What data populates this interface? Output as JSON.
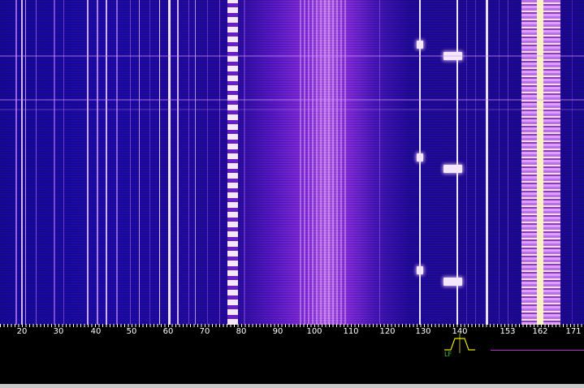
{
  "frequency_axis": {
    "labels": [
      "20",
      "30",
      "40",
      "50",
      "60",
      "70",
      "80",
      "90",
      "100",
      "110",
      "120",
      "130",
      "140",
      "153",
      "162",
      "171"
    ]
  },
  "filter": {
    "label": "LF",
    "color": "#37c837"
  },
  "colors": {
    "background": "#000000",
    "waterfall_base": "#1d0aa8",
    "signal_peak": "#f4e6ff",
    "marker": "#c020d8",
    "status_bar": "#c8c8c8"
  }
}
